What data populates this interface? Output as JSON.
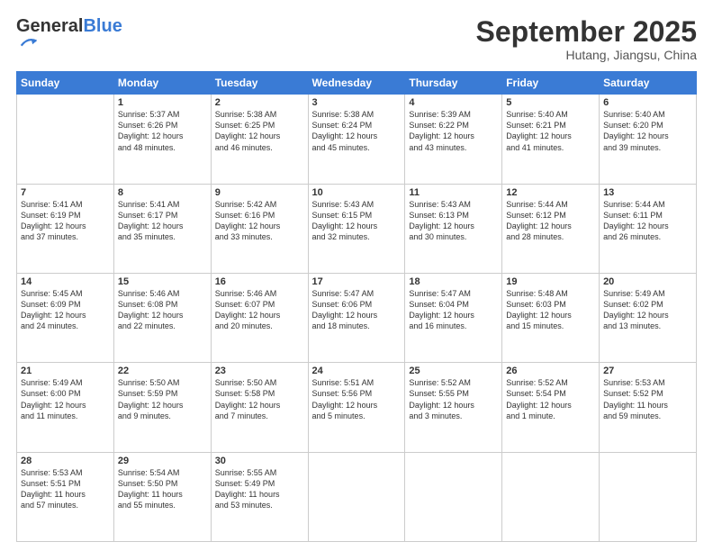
{
  "header": {
    "logo_general": "General",
    "logo_blue": "Blue",
    "month": "September 2025",
    "location": "Hutang, Jiangsu, China"
  },
  "weekdays": [
    "Sunday",
    "Monday",
    "Tuesday",
    "Wednesday",
    "Thursday",
    "Friday",
    "Saturday"
  ],
  "weeks": [
    [
      {
        "day": "",
        "info": ""
      },
      {
        "day": "1",
        "info": "Sunrise: 5:37 AM\nSunset: 6:26 PM\nDaylight: 12 hours\nand 48 minutes."
      },
      {
        "day": "2",
        "info": "Sunrise: 5:38 AM\nSunset: 6:25 PM\nDaylight: 12 hours\nand 46 minutes."
      },
      {
        "day": "3",
        "info": "Sunrise: 5:38 AM\nSunset: 6:24 PM\nDaylight: 12 hours\nand 45 minutes."
      },
      {
        "day": "4",
        "info": "Sunrise: 5:39 AM\nSunset: 6:22 PM\nDaylight: 12 hours\nand 43 minutes."
      },
      {
        "day": "5",
        "info": "Sunrise: 5:40 AM\nSunset: 6:21 PM\nDaylight: 12 hours\nand 41 minutes."
      },
      {
        "day": "6",
        "info": "Sunrise: 5:40 AM\nSunset: 6:20 PM\nDaylight: 12 hours\nand 39 minutes."
      }
    ],
    [
      {
        "day": "7",
        "info": "Sunrise: 5:41 AM\nSunset: 6:19 PM\nDaylight: 12 hours\nand 37 minutes."
      },
      {
        "day": "8",
        "info": "Sunrise: 5:41 AM\nSunset: 6:17 PM\nDaylight: 12 hours\nand 35 minutes."
      },
      {
        "day": "9",
        "info": "Sunrise: 5:42 AM\nSunset: 6:16 PM\nDaylight: 12 hours\nand 33 minutes."
      },
      {
        "day": "10",
        "info": "Sunrise: 5:43 AM\nSunset: 6:15 PM\nDaylight: 12 hours\nand 32 minutes."
      },
      {
        "day": "11",
        "info": "Sunrise: 5:43 AM\nSunset: 6:13 PM\nDaylight: 12 hours\nand 30 minutes."
      },
      {
        "day": "12",
        "info": "Sunrise: 5:44 AM\nSunset: 6:12 PM\nDaylight: 12 hours\nand 28 minutes."
      },
      {
        "day": "13",
        "info": "Sunrise: 5:44 AM\nSunset: 6:11 PM\nDaylight: 12 hours\nand 26 minutes."
      }
    ],
    [
      {
        "day": "14",
        "info": "Sunrise: 5:45 AM\nSunset: 6:09 PM\nDaylight: 12 hours\nand 24 minutes."
      },
      {
        "day": "15",
        "info": "Sunrise: 5:46 AM\nSunset: 6:08 PM\nDaylight: 12 hours\nand 22 minutes."
      },
      {
        "day": "16",
        "info": "Sunrise: 5:46 AM\nSunset: 6:07 PM\nDaylight: 12 hours\nand 20 minutes."
      },
      {
        "day": "17",
        "info": "Sunrise: 5:47 AM\nSunset: 6:06 PM\nDaylight: 12 hours\nand 18 minutes."
      },
      {
        "day": "18",
        "info": "Sunrise: 5:47 AM\nSunset: 6:04 PM\nDaylight: 12 hours\nand 16 minutes."
      },
      {
        "day": "19",
        "info": "Sunrise: 5:48 AM\nSunset: 6:03 PM\nDaylight: 12 hours\nand 15 minutes."
      },
      {
        "day": "20",
        "info": "Sunrise: 5:49 AM\nSunset: 6:02 PM\nDaylight: 12 hours\nand 13 minutes."
      }
    ],
    [
      {
        "day": "21",
        "info": "Sunrise: 5:49 AM\nSunset: 6:00 PM\nDaylight: 12 hours\nand 11 minutes."
      },
      {
        "day": "22",
        "info": "Sunrise: 5:50 AM\nSunset: 5:59 PM\nDaylight: 12 hours\nand 9 minutes."
      },
      {
        "day": "23",
        "info": "Sunrise: 5:50 AM\nSunset: 5:58 PM\nDaylight: 12 hours\nand 7 minutes."
      },
      {
        "day": "24",
        "info": "Sunrise: 5:51 AM\nSunset: 5:56 PM\nDaylight: 12 hours\nand 5 minutes."
      },
      {
        "day": "25",
        "info": "Sunrise: 5:52 AM\nSunset: 5:55 PM\nDaylight: 12 hours\nand 3 minutes."
      },
      {
        "day": "26",
        "info": "Sunrise: 5:52 AM\nSunset: 5:54 PM\nDaylight: 12 hours\nand 1 minute."
      },
      {
        "day": "27",
        "info": "Sunrise: 5:53 AM\nSunset: 5:52 PM\nDaylight: 11 hours\nand 59 minutes."
      }
    ],
    [
      {
        "day": "28",
        "info": "Sunrise: 5:53 AM\nSunset: 5:51 PM\nDaylight: 11 hours\nand 57 minutes."
      },
      {
        "day": "29",
        "info": "Sunrise: 5:54 AM\nSunset: 5:50 PM\nDaylight: 11 hours\nand 55 minutes."
      },
      {
        "day": "30",
        "info": "Sunrise: 5:55 AM\nSunset: 5:49 PM\nDaylight: 11 hours\nand 53 minutes."
      },
      {
        "day": "",
        "info": ""
      },
      {
        "day": "",
        "info": ""
      },
      {
        "day": "",
        "info": ""
      },
      {
        "day": "",
        "info": ""
      }
    ]
  ]
}
